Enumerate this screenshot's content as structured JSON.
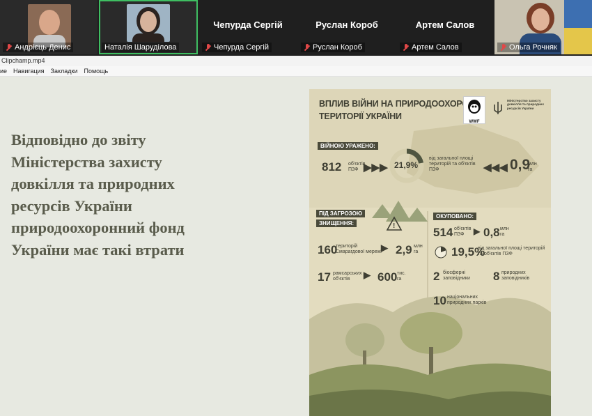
{
  "participants": [
    {
      "name": "Андрієць Денис",
      "muted": true,
      "has_video": true
    },
    {
      "name": "Наталія Шаруділова",
      "muted": false,
      "has_video": true,
      "active": true
    },
    {
      "name": "Чепурда Сергій",
      "muted": true,
      "has_video": false
    },
    {
      "name": "Руслан Короб",
      "muted": true,
      "has_video": false
    },
    {
      "name": "Артем Салов",
      "muted": true,
      "has_video": false
    },
    {
      "name": "Ольга Рочняк",
      "muted": true,
      "has_video": true
    }
  ],
  "window": {
    "title": "Clipchamp.mp4"
  },
  "menu": [
    "ие",
    "Навигация",
    "Закладки",
    "Помощь"
  ],
  "slide": {
    "text_lines": [
      "Відповідно до звіту",
      "Міністерства захисту",
      "довкілля та природних",
      "ресурсів України",
      "природоохоронний фонд",
      "України має такі втрати"
    ]
  },
  "poster": {
    "title_line1": "ВПЛИВ ВІЙНИ НА ПРИРОДООХОРОННІ",
    "title_line2": "ТЕРИТОРІЇ УКРАЇНИ",
    "wwf": "WWF",
    "ministry": "Міністерство захисту довкілля та природних ресурсів України",
    "affected_label": "ВІЙНОЮ УРАЖЕНО:",
    "affected_count": "812",
    "affected_count_unit": "об'єктів ПЗФ",
    "affected_pct": "21,9%",
    "affected_pct_desc": "від загальної площі територій та об'єктів ПЗФ",
    "affected_area": "0,9",
    "affected_area_unit": "млн га",
    "threat_label1": "ПІД ЗАГРОЗОЮ",
    "threat_label2": "ЗНИЩЕННЯ:",
    "emerald_count": "160",
    "emerald_desc": "територій Смарагдової мережі",
    "emerald_area": "2,9",
    "emerald_area_unit": "млн га",
    "ramsar_count": "17",
    "ramsar_desc": "рамсарських об'єктів",
    "ramsar_area": "600",
    "ramsar_area_unit": "тис. га",
    "occupied_label": "ОКУПОВАНО:",
    "occ_count": "514",
    "occ_count_unit": "об'єктів ПЗФ",
    "occ_area": "0,8",
    "occ_area_unit": "млн га",
    "occ_pct": "19,5%",
    "occ_pct_desc": "від загальної площі територій та об'єктів ПЗФ",
    "bio_count": "2",
    "bio_desc": "біосферні заповідники",
    "nat_res_count": "8",
    "nat_res_desc": "природних заповідників",
    "parks_count": "10",
    "parks_desc": "національних природних парків"
  },
  "colors": {
    "active_border": "#3fbf62",
    "muted_mic": "#e04848",
    "poster_bg": "#ddd6b8",
    "slide_text": "#5a5c4c"
  }
}
